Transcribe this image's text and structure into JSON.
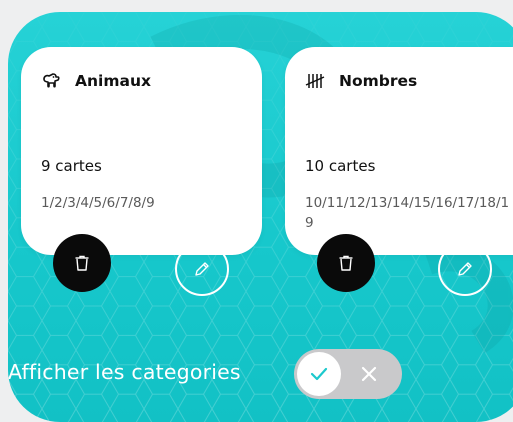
{
  "categories": [
    {
      "title": "Animaux",
      "icon": "dog-icon",
      "count": "9 cartes",
      "items": "1/2/3/4/5/6/7/8/9"
    },
    {
      "title": "Nombres",
      "icon": "tally-marks-icon",
      "count": "10 cartes",
      "items": "10/11/12/13/14/15/16/17/18/19"
    }
  ],
  "toggle": {
    "label": "Afficher les categories",
    "state": "on",
    "on_icon": "check-icon",
    "off_icon": "close-icon"
  },
  "actions": {
    "delete_icon": "trash-icon",
    "edit_icon": "pencil-icon"
  },
  "colors": {
    "background_teal": "#1cc9cd",
    "card": "#ffffff",
    "delete_button": "#0a0a0a",
    "toggle_track": "#c9c9cb",
    "toggle_check": "#1cc9cd"
  }
}
